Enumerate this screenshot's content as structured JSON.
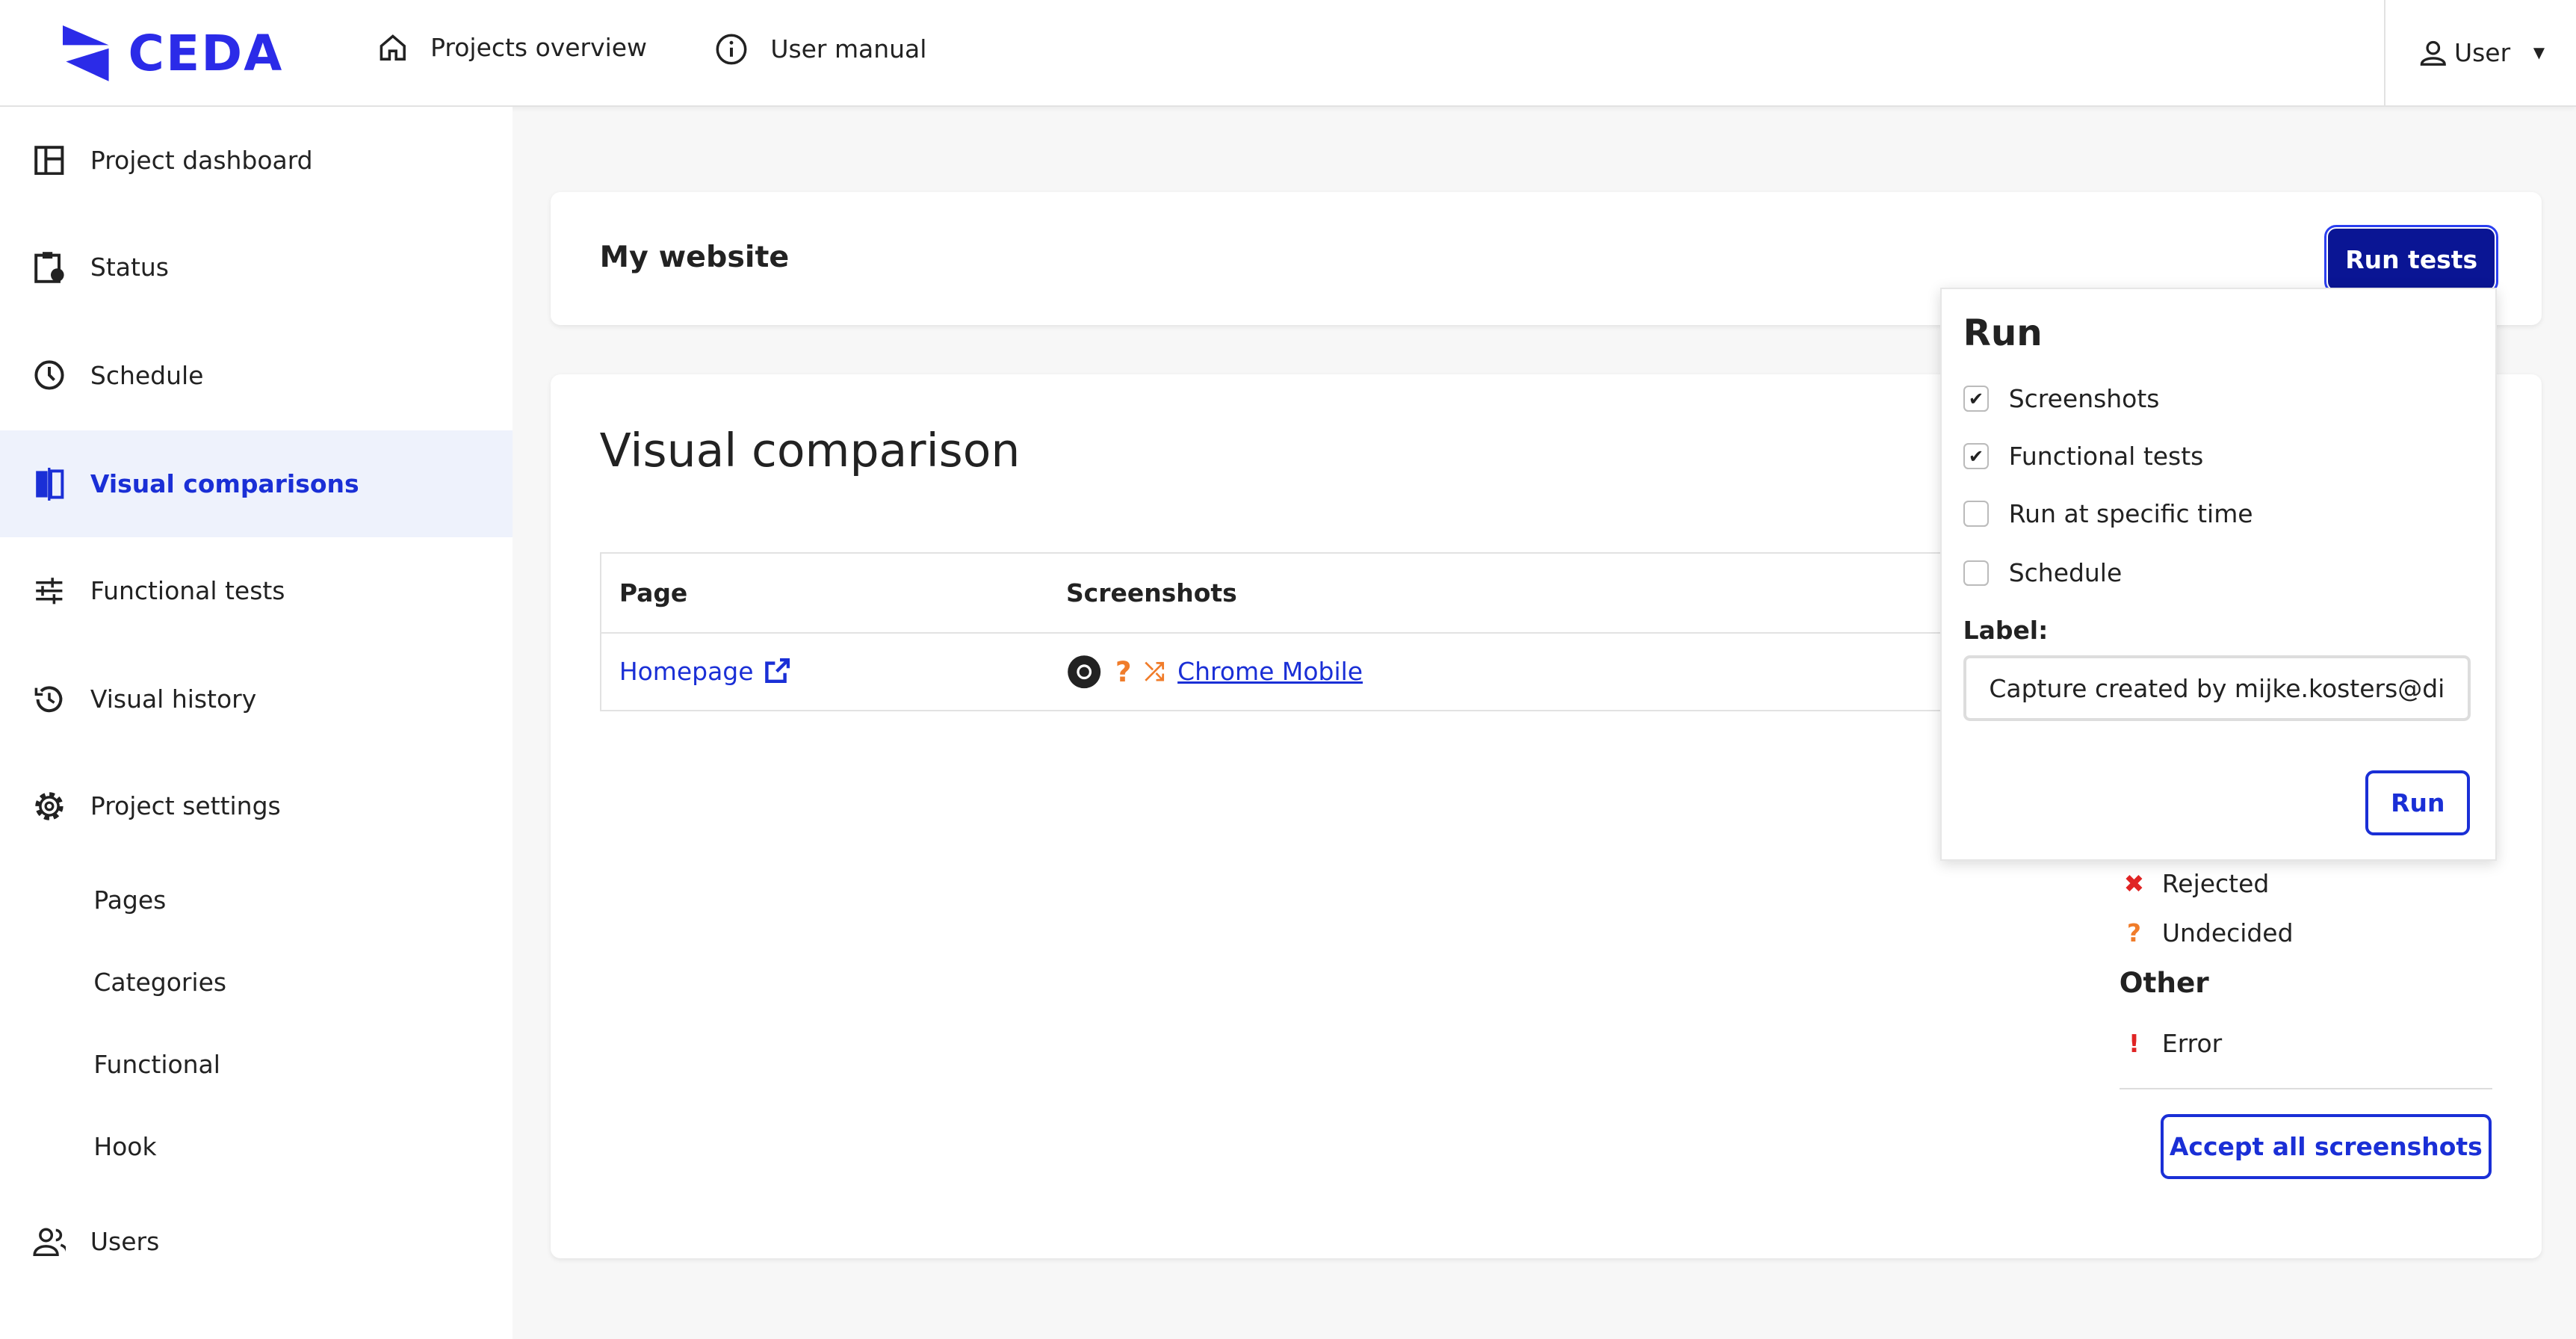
{
  "header": {
    "logo": "CEDA",
    "nav": [
      {
        "label": "Projects overview",
        "icon": "home-icon"
      },
      {
        "label": "User manual",
        "icon": "info-icon"
      }
    ],
    "user": "User"
  },
  "sidebar": {
    "items": [
      {
        "label": "Project dashboard",
        "icon": "dashboard-icon"
      },
      {
        "label": "Status",
        "icon": "clipboard-clock-icon"
      },
      {
        "label": "Schedule",
        "icon": "clock-icon"
      },
      {
        "label": "Visual comparisons",
        "icon": "compare-icon",
        "active": true
      },
      {
        "label": "Functional tests",
        "icon": "sliders-icon"
      },
      {
        "label": "Visual history",
        "icon": "history-icon"
      },
      {
        "label": "Project settings",
        "icon": "gear-icon"
      }
    ],
    "subitems": [
      "Pages",
      "Categories",
      "Functional",
      "Hook"
    ],
    "users": {
      "label": "Users",
      "icon": "users-icon"
    }
  },
  "project": {
    "title": "My website",
    "run_tests": "Run tests"
  },
  "main": {
    "title": "Visual comparison",
    "table": {
      "headers": [
        "Page",
        "Screenshots"
      ],
      "rows": [
        {
          "page": "Homepage",
          "browser": "Chrome Mobile",
          "status": "undecided"
        }
      ]
    },
    "legend": {
      "rejected": "Rejected",
      "undecided": "Undecided",
      "other_heading": "Other",
      "error": "Error"
    },
    "accept_all": "Accept all screenshots"
  },
  "popup": {
    "title": "Run",
    "options": [
      {
        "label": "Screenshots",
        "checked": true
      },
      {
        "label": "Functional tests",
        "checked": true
      },
      {
        "label": "Run at specific time",
        "checked": false
      },
      {
        "label": "Schedule",
        "checked": false
      }
    ],
    "label_heading": "Label:",
    "label_value": "Capture created by mijke.kosters@dig",
    "run": "Run"
  },
  "colors": {
    "brand": "#2b2be8",
    "navy": "#0a1594",
    "link": "#1a2fd6",
    "orange": "#f07c2a",
    "red": "#e02424"
  }
}
